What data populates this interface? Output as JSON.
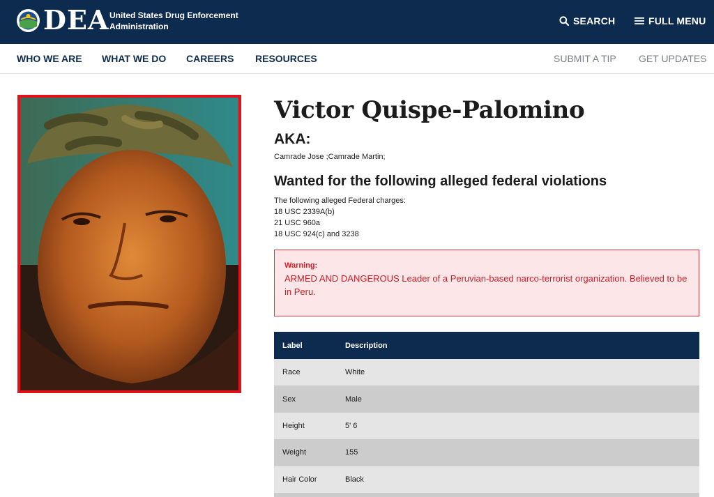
{
  "header": {
    "logo_text": "DEA",
    "agency_name": "United States Drug Enforcement Administration",
    "search_label": "SEARCH",
    "menu_label": "FULL MENU"
  },
  "nav": {
    "primary": [
      "WHO WE ARE",
      "WHAT WE DO",
      "CAREERS",
      "RESOURCES"
    ],
    "secondary": [
      "SUBMIT A TIP",
      "GET UPDATES"
    ]
  },
  "profile": {
    "name": "Victor Quispe-Palomino",
    "aka_heading": "AKA:",
    "aka_value": "Camrade Jose ;Camrade Martin;",
    "violations_heading": "Wanted for the following alleged federal violations",
    "charges_intro": "The following alleged Federal charges:",
    "charges": [
      "18 USC 2339A(b)",
      "21 USC 960a",
      "18 USC 924(c) and 3238"
    ]
  },
  "warning": {
    "label": "Warning:",
    "text": "ARMED AND DANGEROUS Leader of a Peruvian-based narco-terrorist organization. Believed to be in Peru."
  },
  "details_table": {
    "headers": [
      "Label",
      "Description"
    ],
    "rows": [
      [
        "Race",
        "White"
      ],
      [
        "Sex",
        "Male"
      ],
      [
        "Height",
        "5' 6"
      ],
      [
        "Weight",
        "155"
      ],
      [
        "Hair Color",
        "Black"
      ]
    ]
  },
  "colors": {
    "brand_navy": "#0d2a4f",
    "warning_red": "#d01c24",
    "photo_border": "#e0131d"
  }
}
